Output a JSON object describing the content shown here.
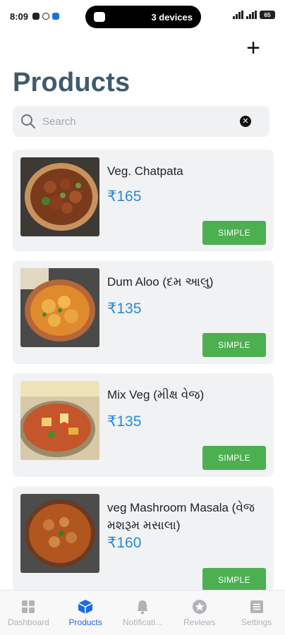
{
  "status_bar": {
    "time": "8:09",
    "pill_text": "3 devices",
    "battery": "65"
  },
  "header": {
    "add_icon": "plus-icon",
    "title": "Products"
  },
  "search": {
    "placeholder": "Search",
    "value": ""
  },
  "products": [
    {
      "name": "Veg. Chatpata",
      "price": "₹165",
      "type": "SIMPLE"
    },
    {
      "name": "Dum Aloo (દમ આલુ)",
      "price": "₹135",
      "type": "SIMPLE"
    },
    {
      "name": "Mix Veg (મીક્ષ વેજ)",
      "price": "₹135",
      "type": "SIMPLE"
    },
    {
      "name": "veg Mashroom Masala (વેજ મશરૂમ મસાલા)",
      "price": "₹160",
      "type": "SIMPLE"
    }
  ],
  "tabs": [
    {
      "label": "Dashboard",
      "icon": "grid-icon",
      "active": false
    },
    {
      "label": "Products",
      "icon": "box-icon",
      "active": true
    },
    {
      "label": "Notificati...",
      "icon": "bell-icon",
      "active": false
    },
    {
      "label": "Reviews",
      "icon": "star-icon",
      "active": false
    },
    {
      "label": "Settings",
      "icon": "list-icon",
      "active": false
    }
  ],
  "colors": {
    "accent": "#1d6be0",
    "title": "#3f5a6d",
    "price": "#2a8ad4",
    "type_button": "#4caf50"
  }
}
